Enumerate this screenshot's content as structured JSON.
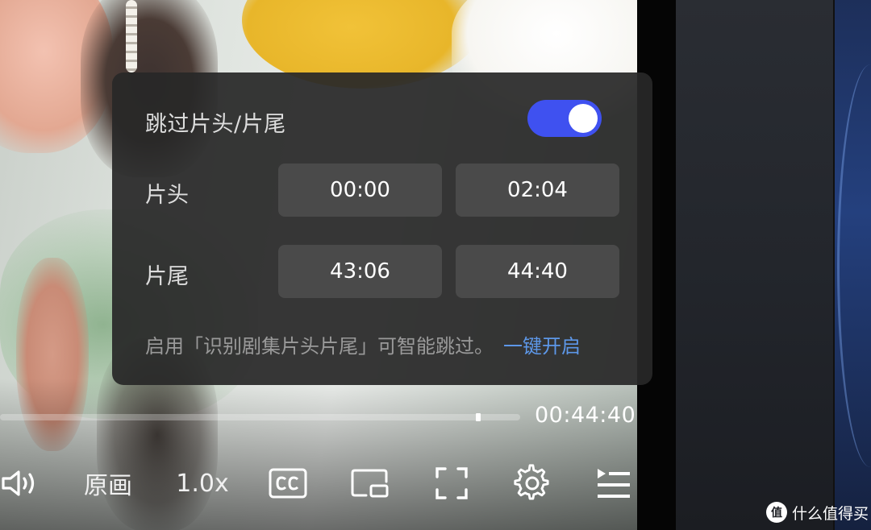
{
  "skip_panel": {
    "title": "跳过片头/片尾",
    "enabled": true,
    "toggle_color": "#3f51f0",
    "intro_label": "片头",
    "intro_start": "00:00",
    "intro_end": "02:04",
    "outro_label": "片尾",
    "outro_start": "43:06",
    "outro_end": "44:40",
    "hint_text": "启用「识别剧集片头片尾」可智能跳过。",
    "hint_link": "一键开启",
    "link_color": "#5d97e8"
  },
  "player": {
    "duration": "00:44:40",
    "progress_marker_fraction": 0.92,
    "controls": {
      "volume_icon": "speaker-icon",
      "quality_label": "原画",
      "speed_label": "1.0x",
      "subtitle_icon": "cc-icon",
      "pip_icon": "picture-in-picture-icon",
      "fullscreen_icon": "fullscreen-icon",
      "settings_icon": "gear-icon",
      "playlist_icon": "playlist-icon"
    }
  },
  "watermark": {
    "logo": "值",
    "text": "什么值得买"
  }
}
